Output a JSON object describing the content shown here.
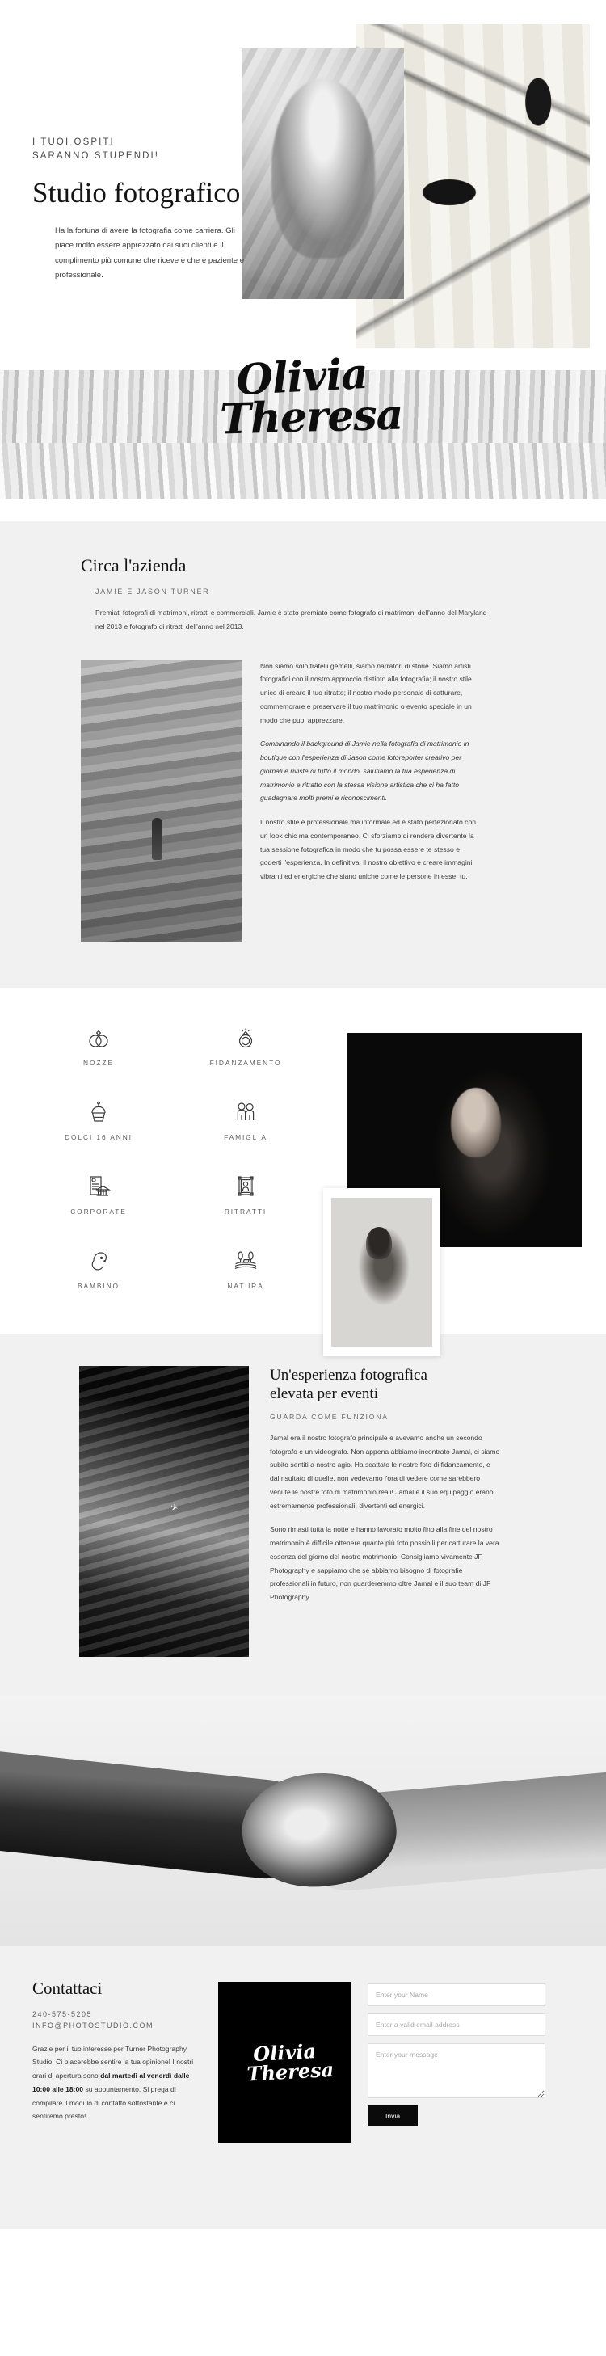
{
  "hero": {
    "eyebrow_line1": "I TUOI OSPITI",
    "eyebrow_line2": "SARANNO STUPENDI!",
    "title": "Studio fotografico",
    "paragraph": "Ha la fortuna di avere la fotografia come carriera. Gli piace molto essere apprezzato dai suoi clienti e il complimento più comune che riceve è che è paziente e professionale."
  },
  "signature": {
    "line1": "Olivia",
    "line2": "Theresa"
  },
  "about": {
    "title": "Circa l'azienda",
    "subtitle": "JAMIE E JASON TURNER",
    "lead": "Premiati fotografi di matrimoni, ritratti e commerciali. Jamie è stato premiato come fotografo di matrimoni dell'anno del Maryland nel 2013 e fotografo di ritratti dell'anno nel 2013.",
    "paragraph1": "Non siamo solo fratelli gemelli, siamo narratori di storie. Siamo artisti fotografici con il nostro approccio distinto alla fotografia; il nostro stile unico di creare il tuo ritratto; il nostro modo personale di catturare, commemorare e preservare il tuo matrimonio o evento speciale in un modo che puoi apprezzare.",
    "paragraph2": "Combinando il background di Jamie nella fotografia di matrimonio in boutique con l'esperienza di Jason come fotoreporter creativo per giornali e riviste di tutto il mondo, salutiamo la tua esperienza di matrimonio e ritratto con la stessa visione artistica che ci ha fatto guadagnare molti premi e riconoscimenti.",
    "paragraph3": "Il nostro stile è professionale ma informale ed è stato perfezionato con un look chic ma contemporaneo. Ci sforziamo di rendere divertente la tua sessione fotografica in modo che tu possa essere te stesso e goderti l'esperienza. In definitiva, il nostro obiettivo è creare immagini vibranti ed energiche che siano uniche come le persone in esse, tu."
  },
  "services": {
    "items": [
      {
        "icon": "wedding-rings-icon",
        "label": "NOZZE"
      },
      {
        "icon": "engagement-ring-icon",
        "label": "FIDANZAMENTO"
      },
      {
        "icon": "cupcake-icon",
        "label": "DOLCI 16 ANNI"
      },
      {
        "icon": "family-couple-icon",
        "label": "FAMIGLIA"
      },
      {
        "icon": "corporate-building-icon",
        "label": "CORPORATE"
      },
      {
        "icon": "portrait-frame-icon",
        "label": "RITRATTI"
      },
      {
        "icon": "baby-icon",
        "label": "BAMBINO"
      },
      {
        "icon": "nature-landscape-icon",
        "label": "NATURA"
      }
    ]
  },
  "experience": {
    "title_line1": "Un'esperienza fotografica",
    "title_line2": "elevata per eventi",
    "subtitle": "GUARDA COME FUNZIONA",
    "paragraph1": "Jamal era il nostro fotografo principale e avevamo anche un secondo fotografo e un videografo. Non appena abbiamo incontrato Jamal, ci siamo subito sentiti a nostro agio. Ha scattato le nostre foto di fidanzamento, e dal risultato di quelle, non vedevamo l'ora di vedere come sarebbero venute le nostre foto di matrimonio reali! Jamal e il suo equipaggio erano estremamente professionali, divertenti ed energici.",
    "paragraph2": "Sono rimasti tutta la notte e hanno lavorato molto fino alla fine del nostro matrimonio è difficile ottenere quante più foto possibili per catturare la vera essenza del giorno del nostro matrimonio. Consigliamo vivamente JF Photography e sappiamo che se abbiamo bisogno di fotografie professionali in futuro, non guarderemmo oltre Jamal e il suo team di JF Photography."
  },
  "contact": {
    "title": "Contattaci",
    "phone": "240-575-5205",
    "email": "INFO@PHOTOSTUDIO.COM",
    "body_part1": "Grazie per il tuo interesse per Turner Photography Studio. Ci piacerebbe sentire la tua opinione! I nostri orari di apertura sono ",
    "body_bold": "dal martedì al venerdì dalle 10:00 alle 18:00",
    "body_part2": " su appuntamento. Si prega di compilare il modulo di contatto sottostante e ci sentiremo presto!",
    "card_line1": "Olivia",
    "card_line2": "Theresa",
    "form": {
      "name_placeholder": "Enter your Name",
      "name_value": "",
      "email_placeholder": "Enter a valid email address",
      "email_value": "",
      "message_placeholder": "Enter your message",
      "message_value": "",
      "submit_label": "Invia"
    }
  },
  "colors": {
    "page_bg": "#ffffff",
    "section_bg": "#f1f1f1",
    "ink": "#141414",
    "muted": "#6a6a6a",
    "accent_black": "#0b0b0b"
  }
}
